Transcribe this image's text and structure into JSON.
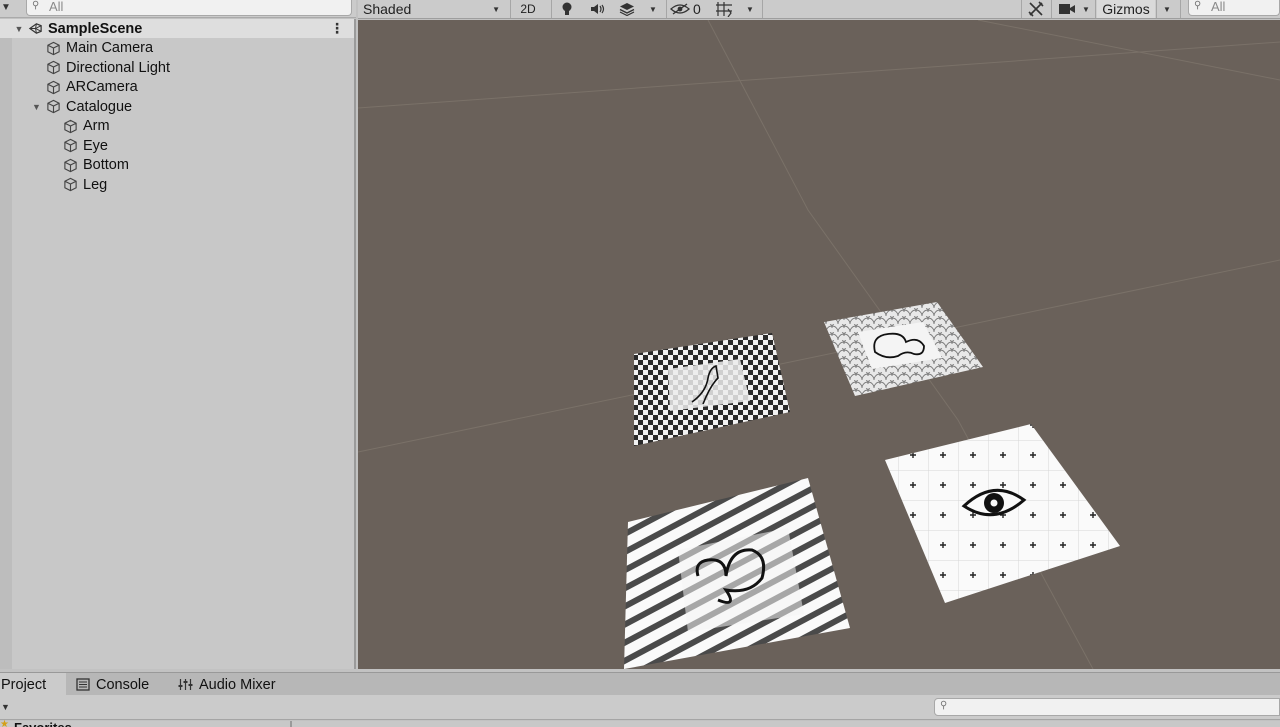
{
  "hierarchy": {
    "search_placeholder": "All",
    "scene_name": "SampleScene",
    "items": [
      {
        "label": "Main Camera"
      },
      {
        "label": "Directional Light"
      },
      {
        "label": "ARCamera"
      },
      {
        "label": "Catalogue"
      }
    ],
    "catalogue_children": [
      {
        "label": "Arm"
      },
      {
        "label": "Eye"
      },
      {
        "label": "Bottom"
      },
      {
        "label": "Leg"
      }
    ]
  },
  "scene_toolbar": {
    "draw_mode": "Shaded",
    "mode_2d": "2D",
    "hidden_count": "0",
    "gizmos_label": "Gizmos",
    "search_placeholder": "All"
  },
  "bottom_panel": {
    "tabs": [
      {
        "label": "Project"
      },
      {
        "label": "Console"
      },
      {
        "label": "Audio Mixer"
      }
    ],
    "favorites_label": "Favorites"
  },
  "icons": {
    "scene": "unity-scene-icon",
    "gameobject": "cube-icon",
    "lighting": "lightbulb-icon",
    "audio": "speaker-icon",
    "effects": "layers-icon",
    "visibility": "eye-slash-icon",
    "grid": "grid-icon",
    "tools": "tools-icon",
    "camera": "camera-icon",
    "console": "console-icon",
    "mixer": "sliders-icon",
    "search": "search-icon"
  },
  "colors": {
    "scene_background": "#6a615a",
    "panel": "#c8c8c8",
    "selected_row": "#dedede"
  }
}
